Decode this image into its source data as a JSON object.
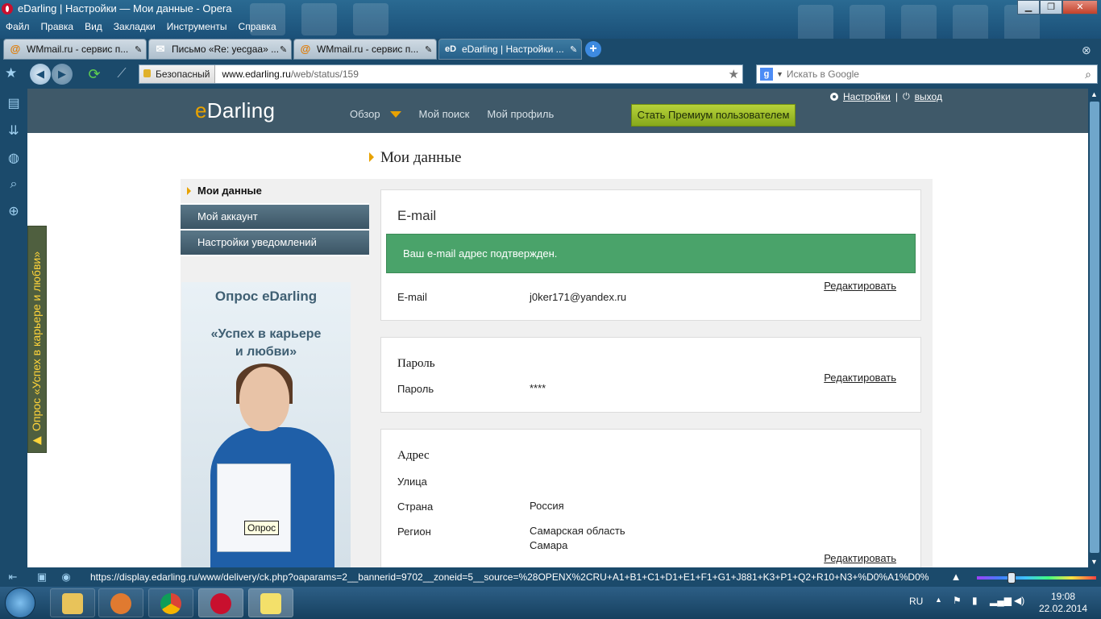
{
  "window": {
    "title": "eDarling | Настройки — Мои данные - Opera",
    "menu": [
      "Файл",
      "Правка",
      "Вид",
      "Закладки",
      "Инструменты",
      "Справка"
    ]
  },
  "tabs": [
    {
      "label": "WMmail.ru - сервис п...",
      "icon": "wmmail-icon"
    },
    {
      "label": "Письмо «Re: уесgaa» ...",
      "icon": "mail-icon"
    },
    {
      "label": "WMmail.ru - сервис п...",
      "icon": "wmmail-icon"
    },
    {
      "label": "eDarling | Настройки ...",
      "icon": "edarling-icon",
      "active": true
    }
  ],
  "address": {
    "security_label": "Безопасный",
    "url_domain": "www.edarling.ru",
    "url_path": "/web/status/159",
    "search_placeholder": "Искать в Google"
  },
  "site": {
    "logo_e": "e",
    "logo_rest": "Darling",
    "nav": [
      "Обзор",
      "Мой поиск",
      "Мой профиль"
    ],
    "premium_button": "Стать Премиум пользователем",
    "settings_link": "Настройки",
    "logout_link": "выход",
    "separator": "|"
  },
  "page": {
    "title": "Мои данные",
    "sidebar": [
      "Мои данные",
      "Мой аккаунт",
      "Настройки уведомлений"
    ],
    "promo": {
      "title": "Опрос eDarling",
      "subtitle_line1": "«Успех в карьере",
      "subtitle_line2": "и любви»",
      "tooltip": "Опрос"
    },
    "side_tab": "▶ Опрос «Успех в карьере и любви»",
    "email_card": {
      "title": "E-mail",
      "alert": "Ваш e-mail адрес подтвержден.",
      "label": "E-mail",
      "value": "j0ker171@yandex.ru",
      "edit": "Редактировать"
    },
    "password_card": {
      "title": "Пароль",
      "label": "Пароль",
      "value": "****",
      "edit": "Редактировать"
    },
    "address_card": {
      "title": "Адрес",
      "street_label": "Улица",
      "country_label": "Страна",
      "country_value": "Россия",
      "region_label": "Регион",
      "region_value_1": "Самарская область",
      "region_value_2": "Самара",
      "edit": "Редактировать"
    }
  },
  "statusbar": {
    "url": "https://display.edarling.ru/www/delivery/ck.php?oaparams=2__bannerid=9702__zoneid=5__source=%28OPENX%2CRU+A1+B1+C1+D1+E1+F1+G1+J881+K3+P1+Q2+R10+N3+%D0%A1%D0%B0..."
  },
  "taskbar": {
    "language": "RU",
    "time": "19:08",
    "date": "22.02.2014"
  },
  "colors": {
    "accent_orange": "#e8a200",
    "header_bg": "#3f5969",
    "success_green": "#4aa36a",
    "premium_green": "#9fbf2a"
  }
}
